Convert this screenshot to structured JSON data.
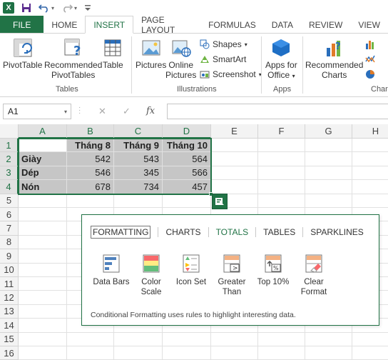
{
  "qat": {
    "logo_text": "X"
  },
  "tabs": [
    "FILE",
    "HOME",
    "INSERT",
    "PAGE LAYOUT",
    "FORMULAS",
    "DATA",
    "REVIEW",
    "VIEW"
  ],
  "active_tab": "INSERT",
  "ribbon": {
    "pivottable": "PivotTable",
    "recommended_pivottables_1": "Recommended",
    "recommended_pivottables_2": "PivotTables",
    "table": "Table",
    "tables_group": "Tables",
    "pictures": "Pictures",
    "online_pictures_1": "Online",
    "online_pictures_2": "Pictures",
    "shapes": "Shapes",
    "smartart": "SmartArt",
    "screenshot": "Screenshot",
    "illustrations_group": "Illustrations",
    "apps_for_office_1": "Apps for",
    "apps_for_office_2": "Office",
    "apps_group": "Apps",
    "recommended_charts_1": "Recommended",
    "recommended_charts_2": "Charts",
    "charts_group": "Chart"
  },
  "formula_bar": {
    "name_box": "A1",
    "fx": "fx",
    "value": ""
  },
  "columns": [
    "A",
    "B",
    "C",
    "D",
    "E",
    "F",
    "G",
    "H"
  ],
  "rows": [
    "1",
    "2",
    "3",
    "4",
    "5",
    "6",
    "7",
    "8",
    "9",
    "10",
    "11",
    "12",
    "13",
    "14",
    "15",
    "16"
  ],
  "sheet": {
    "headers": [
      "",
      "Tháng 8",
      "Tháng 9",
      "Tháng 10"
    ],
    "data": [
      [
        "Giày",
        "542",
        "543",
        "564"
      ],
      [
        "Dép",
        "546",
        "345",
        "566"
      ],
      [
        "Nón",
        "678",
        "734",
        "457"
      ]
    ]
  },
  "quick_analysis": {
    "tabs": [
      "FORMATTING",
      "CHARTS",
      "TOTALS",
      "TABLES",
      "SPARKLINES"
    ],
    "active_tab": "FORMATTING",
    "items": [
      {
        "line1": "Data Bars",
        "line2": ""
      },
      {
        "line1": "Color",
        "line2": "Scale"
      },
      {
        "line1": "Icon Set",
        "line2": ""
      },
      {
        "line1": "Greater",
        "line2": "Than"
      },
      {
        "line1": "Top 10%",
        "line2": ""
      },
      {
        "line1": "Clear",
        "line2": "Format"
      }
    ],
    "description": "Conditional Formatting uses rules to highlight interesting data."
  },
  "colors": {
    "excel_green": "#217346",
    "selection_gray": "#c6c6c6"
  }
}
